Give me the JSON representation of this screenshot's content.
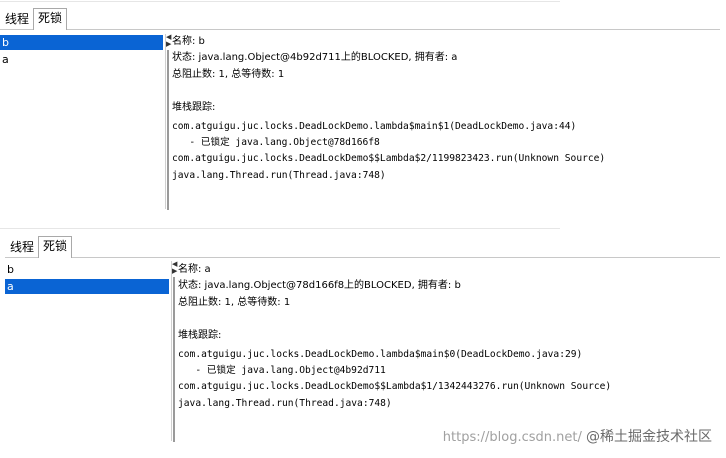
{
  "panel1": {
    "tabs": [
      {
        "label": "线程",
        "active": false
      },
      {
        "label": "死锁",
        "active": true
      }
    ],
    "threads": [
      {
        "label": "b",
        "selected": true
      },
      {
        "label": "a",
        "selected": false
      }
    ],
    "details": {
      "name": "名称: b",
      "state": "状态: java.lang.Object@4b92d711上的BLOCKED, 拥有者: a",
      "counts": "总阻止数: 1, 总等待数: 1",
      "stack_header": "堆栈跟踪:",
      "stack": [
        "com.atguigu.juc.locks.DeadLockDemo.lambda$main$1(DeadLockDemo.java:44)",
        "   - 已锁定 java.lang.Object@78d166f8",
        "com.atguigu.juc.locks.DeadLockDemo$$Lambda$2/1199823423.run(Unknown Source)",
        "java.lang.Thread.run(Thread.java:748)"
      ]
    }
  },
  "panel2": {
    "tabs": [
      {
        "label": "线程",
        "active": false
      },
      {
        "label": "死锁",
        "active": true
      }
    ],
    "threads": [
      {
        "label": "b",
        "selected": false
      },
      {
        "label": "a",
        "selected": true
      }
    ],
    "details": {
      "name": "名称: a",
      "state": "状态: java.lang.Object@78d166f8上的BLOCKED, 拥有者: b",
      "counts": "总阻止数: 1, 总等待数: 1",
      "stack_header": "堆栈跟踪:",
      "stack": [
        "com.atguigu.juc.locks.DeadLockDemo.lambda$main$0(DeadLockDemo.java:29)",
        "   - 已锁定 java.lang.Object@4b92d711",
        "com.atguigu.juc.locks.DeadLockDemo$$Lambda$1/1342443276.run(Unknown Source)",
        "java.lang.Thread.run(Thread.java:748)"
      ]
    }
  },
  "watermark": {
    "url": "https://blog.csdn.net/",
    "brand": "@稀土掘金技术社区"
  },
  "colors": {
    "selection": "#0a64d4",
    "separator": "#9a9a9a"
  }
}
